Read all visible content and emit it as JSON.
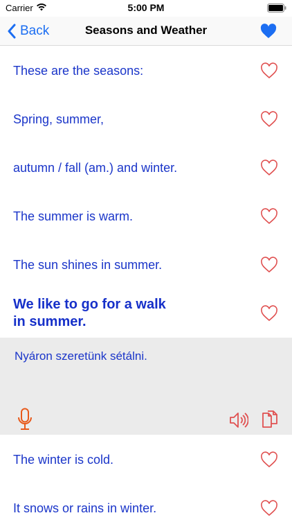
{
  "status": {
    "carrier": "Carrier",
    "time": "5:00 PM"
  },
  "nav": {
    "back_label": "Back",
    "title": "Seasons and Weather"
  },
  "rows": [
    {
      "text": "These are the seasons:"
    },
    {
      "text": "Spring, summer,"
    },
    {
      "text": "autumn / fall (am.) and winter."
    },
    {
      "text": "The summer is warm."
    },
    {
      "text": "The sun shines in summer."
    },
    {
      "text_line1": "We like to go for a walk",
      "text_line2": "in summer."
    },
    {
      "text": "The winter is cold."
    },
    {
      "text": "It snows or rains in winter."
    }
  ],
  "expanded": {
    "translation": "Nyáron szeretünk sétálni."
  },
  "colors": {
    "accent_blue": "#1c6ef2",
    "text_blue": "#1a35c9",
    "heart_red": "#e05050",
    "action_orange": "#e8591a",
    "expanded_bg": "#ebebeb"
  },
  "icons": {
    "wifi": "wifi-icon",
    "battery": "battery-icon",
    "back": "chevron-left-icon",
    "favorite_filled": "heart-filled-icon",
    "favorite_outline": "heart-outline-icon",
    "mic": "microphone-icon",
    "speaker": "speaker-icon",
    "copy": "copy-icon"
  }
}
